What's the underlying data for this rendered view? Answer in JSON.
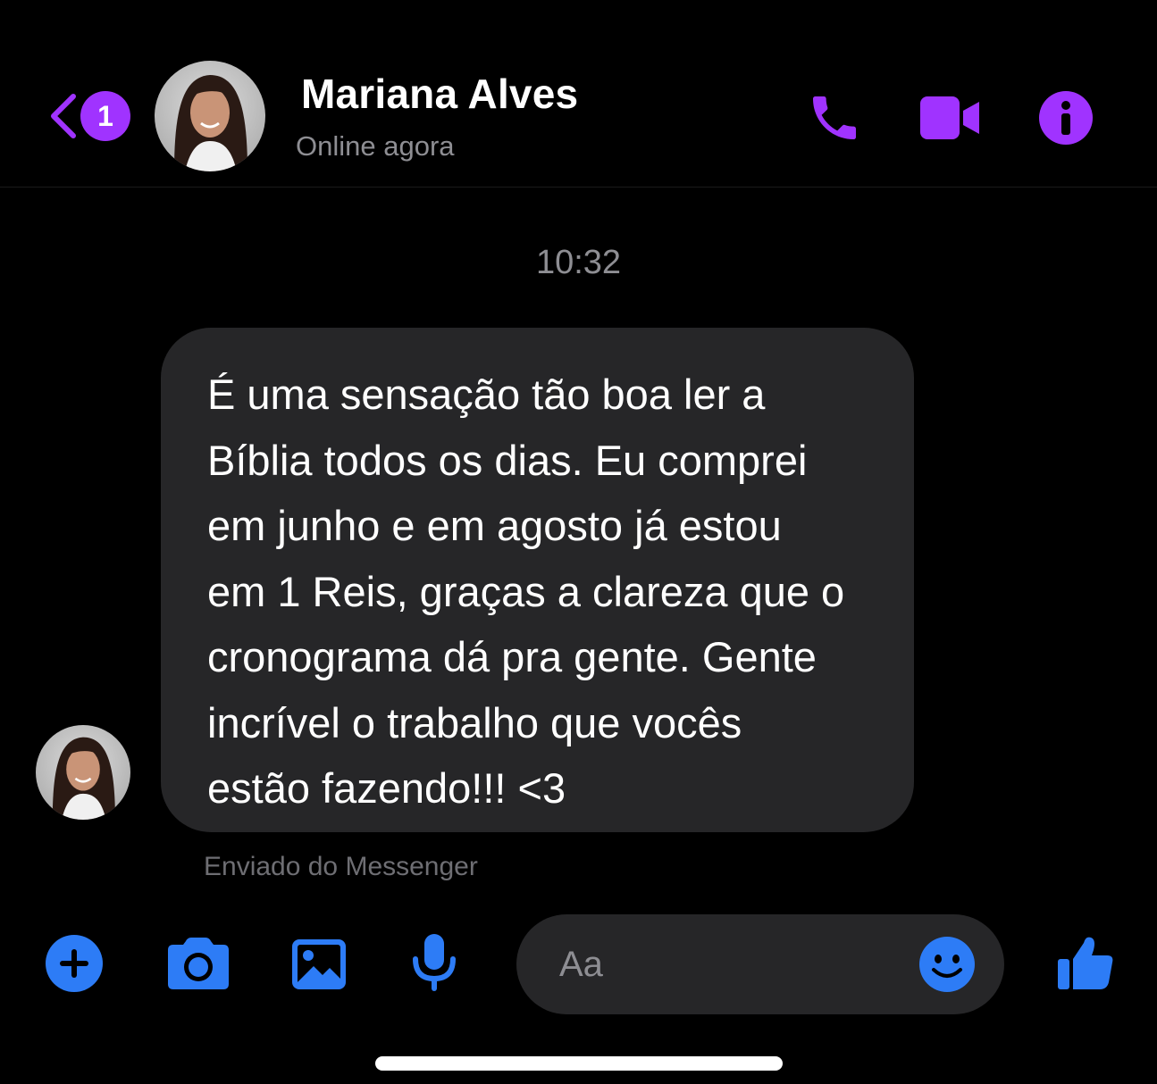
{
  "colors": {
    "accent_purple": "#a033ff",
    "accent_blue": "#2d7cf6",
    "bubble_bg": "#262628",
    "muted_text": "#8e8e93"
  },
  "header": {
    "back_icon": "chevron-left-icon",
    "unread_count": "1",
    "contact_name": "Mariana Alves",
    "status": "Online agora",
    "actions": [
      "phone-icon",
      "video-camera-icon",
      "info-icon"
    ]
  },
  "conversation": {
    "timestamp": "10:32",
    "message": {
      "text": "É uma sensação tão boa ler a\nBíblia todos os dias. Eu comprei\nem junho e em agosto já estou\nem 1 Reis, graças a clareza que o\ncronograma dá pra gente. Gente\nincrível o trabalho que vocês\nestão fazendo!!! <3",
      "footer": "Enviado do Messenger"
    }
  },
  "composer": {
    "icons": [
      "plus-icon",
      "camera-icon",
      "gallery-icon",
      "microphone-icon",
      "emoji-icon",
      "thumbs-up-icon"
    ],
    "placeholder": "Aa"
  }
}
